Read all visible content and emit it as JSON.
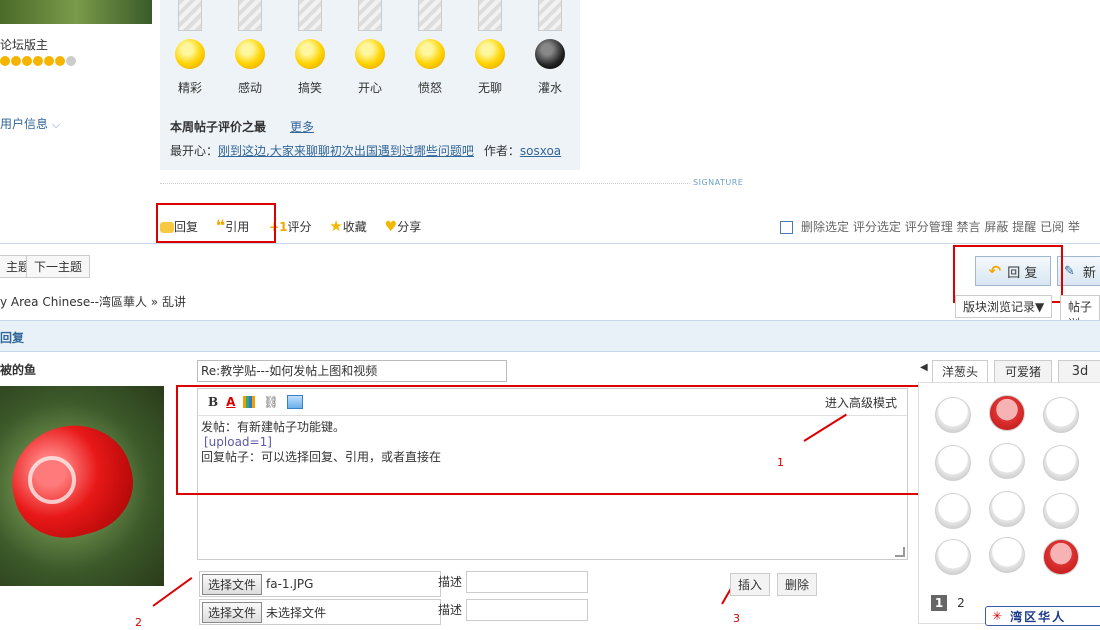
{
  "sidebar": {
    "role": "论坛版主",
    "user_info_link": "用户信息",
    "avatar_name": "被的鱼",
    "title_partial": "回复"
  },
  "votes": [
    {
      "label": "精彩"
    },
    {
      "label": "感动"
    },
    {
      "label": "搞笑"
    },
    {
      "label": "开心"
    },
    {
      "label": "愤怒"
    },
    {
      "label": "无聊"
    },
    {
      "label": "灌水"
    }
  ],
  "weekly": {
    "heading": "本周帖子评价之最",
    "more": "更多",
    "happiest_label": "最开心：",
    "happiest_link": "刚到这边,大家来聊聊初次出国遇到过哪些问题吧",
    "author_label": "作者：",
    "author": "sosxoa"
  },
  "signature_label": "SIGNATURE",
  "post_actions": {
    "reply": "回复",
    "quote": "引用",
    "rate": "评分",
    "favorite": "收藏",
    "share": "分享"
  },
  "mod_actions": {
    "delete_selected": "删除选定",
    "rate_selected": "评分选定",
    "rate_manage": "评分管理",
    "ban": "禁言",
    "block": "屏蔽",
    "remind": "提醒",
    "read": "已阅",
    "report": "举"
  },
  "nav": {
    "prev_topic_partial": "主题",
    "next_topic": "下一主题",
    "breadcrumb_forum": "y Area Chinese--湾區華人",
    "breadcrumb_sep": "»",
    "breadcrumb_current": "乱讲",
    "reply_button": "回 复",
    "new_button_partial": "新",
    "history_dropdown": "版块浏览记录▼",
    "post_history_partial": "帖子浏"
  },
  "editor": {
    "title_value": "Re:教学贴---如何发帖上图和视频",
    "advanced_mode": "进入高级模式",
    "line1": "发帖：有新建帖子功能键。",
    "line2": "[upload=1]",
    "line3": "回复帖子：可以选择回复、引用，或者直接在"
  },
  "uploads": {
    "choose_file": "选择文件",
    "file1": "fa-1.JPG",
    "file2": "未选择文件",
    "desc_label": "描述",
    "insert": "插入",
    "delete": "删除"
  },
  "stickers": {
    "tabs": [
      "洋葱头",
      "可爱猪",
      "3d"
    ],
    "pages": [
      "1",
      "2"
    ],
    "brand": "湾区华人"
  },
  "annotations": [
    "1",
    "2",
    "3"
  ]
}
